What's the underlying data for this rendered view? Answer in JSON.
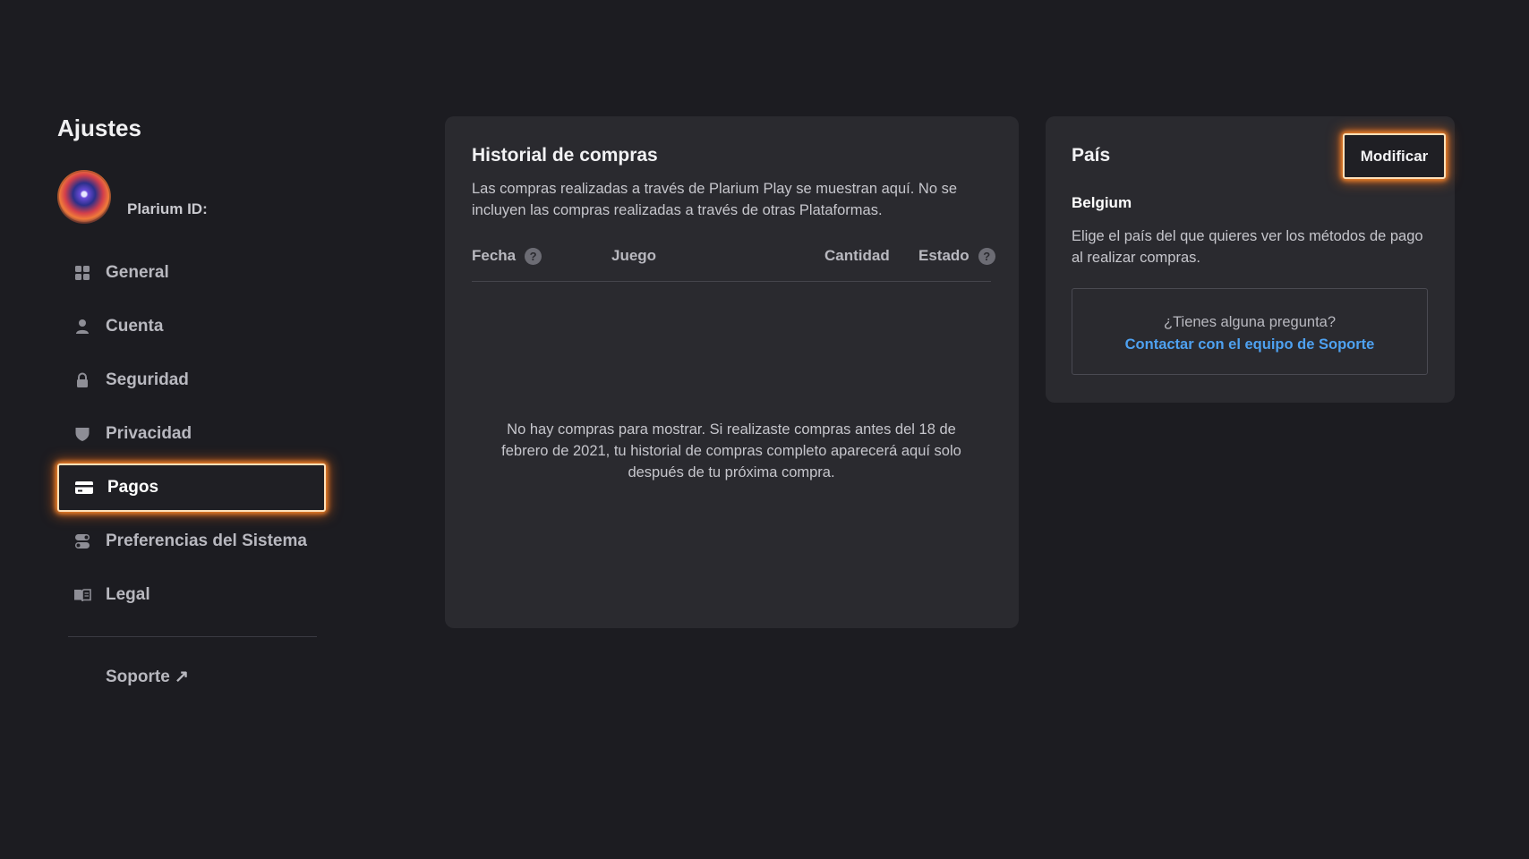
{
  "sidebar": {
    "title": "Ajustes",
    "profile": {
      "label": "Plarium ID:"
    },
    "items": [
      {
        "label": "General",
        "icon": "grid-icon",
        "active": false
      },
      {
        "label": "Cuenta",
        "icon": "user-icon",
        "active": false
      },
      {
        "label": "Seguridad",
        "icon": "lock-icon",
        "active": false
      },
      {
        "label": "Privacidad",
        "icon": "shield-icon",
        "active": false
      },
      {
        "label": "Pagos",
        "icon": "credit-card-icon",
        "active": true
      },
      {
        "label": "Preferencias del Sistema",
        "icon": "toggle-icon",
        "active": false
      },
      {
        "label": "Legal",
        "icon": "book-icon",
        "active": false
      }
    ],
    "support_label": "Soporte ↗"
  },
  "history": {
    "title": "Historial de compras",
    "description": "Las compras realizadas a través de Plarium Play se muestran aquí. No se incluyen las compras realizadas a través de otras Plataformas.",
    "columns": {
      "date": "Fecha",
      "game": "Juego",
      "amount": "Cantidad",
      "status": "Estado"
    },
    "help_glyph": "?",
    "empty_message": "No hay compras para mostrar. Si realizaste compras antes del 18 de febrero de 2021, tu historial de compras completo aparecerá aquí solo después de tu próxima compra."
  },
  "country": {
    "title": "País",
    "modify_label": "Modificar",
    "value": "Belgium",
    "description": "Elige el país del que quieres ver los métodos de pago al realizar compras.",
    "support_question": "¿Tienes alguna pregunta?",
    "support_link": "Contactar con el equipo de Soporte"
  },
  "colors": {
    "background": "#1c1c21",
    "card": "#2a2a2f",
    "focus_glow": "#ff8a2a",
    "link": "#4ea1f0"
  }
}
